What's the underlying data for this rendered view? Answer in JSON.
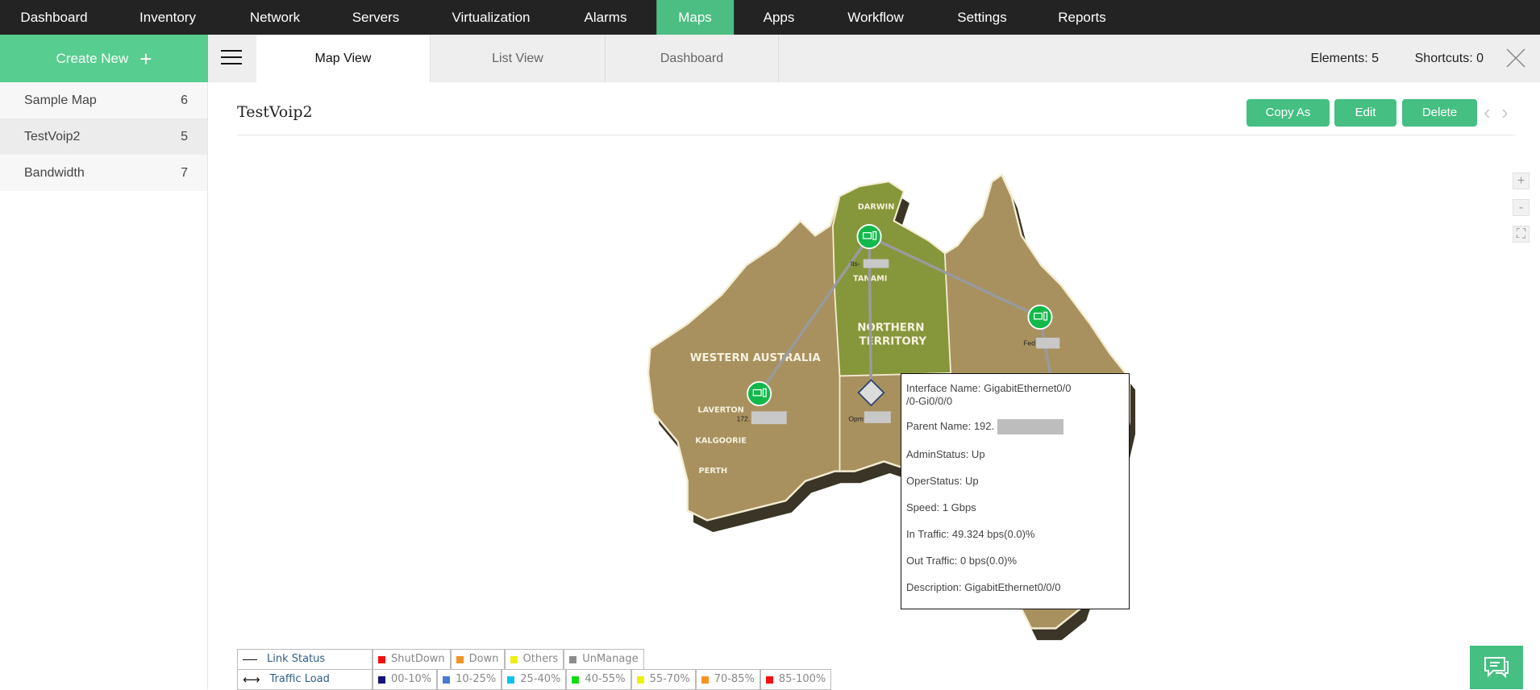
{
  "nav": {
    "items": [
      "Dashboard",
      "Inventory",
      "Network",
      "Servers",
      "Virtualization",
      "Alarms",
      "Maps",
      "Apps",
      "Workflow",
      "Settings",
      "Reports"
    ],
    "active": "Maps"
  },
  "create_new": {
    "label": "Create New",
    "icon": "plus-icon"
  },
  "tabs": [
    "Map View",
    "List View",
    "Dashboard"
  ],
  "counts": {
    "elements": "Elements: 5",
    "shortcuts": "Shortcuts: 0"
  },
  "sidebar": {
    "items": [
      {
        "label": "Sample Map",
        "count": "6"
      },
      {
        "label": "TestVoip2",
        "count": "5"
      },
      {
        "label": "Bandwidth",
        "count": "7"
      }
    ]
  },
  "page_title": "TestVoip2",
  "actions": {
    "copy_as": "Copy As",
    "edit": "Edit",
    "delete": "Delete"
  },
  "zoom_controls": {
    "zoom_in": "+",
    "zoom_out": "-"
  },
  "map": {
    "places": {
      "darwin": "DARWIN",
      "tanami": "TANAMI",
      "nt1": "NORTHERN",
      "nt2": "TERRITORY",
      "wa": "WESTERN AUSTRALIA",
      "laverton": "LAVERTON",
      "kalgoorie": "KALGOORIE",
      "perth": "PERTH"
    },
    "nodes": [
      {
        "label": "Its-",
        "status_color": "#12b94a"
      },
      {
        "label": "Fed",
        "status_color": "#12b94a"
      },
      {
        "label": "172.",
        "status_color": "#12b94a"
      },
      {
        "label": "Opm",
        "type": "interface"
      }
    ]
  },
  "tooltip": {
    "interface_name_1": "Interface Name: GigabitEthernet0/0",
    "interface_name_2": "/0-Gi0/0/0",
    "parent_name": "Parent Name: 192.",
    "admin_status": "AdminStatus: Up",
    "oper_status": "OperStatus: Up",
    "speed": "Speed: 1 Gbps",
    "in_traffic": "In Traffic: 49.324 bps(0.0)%",
    "out_traffic": "Out Traffic: 0 bps(0.0)%",
    "description": "Description: GigabitEthernet0/0/0"
  },
  "legend": {
    "link_status": {
      "label": "Link Status",
      "items": [
        {
          "label": "ShutDown",
          "color": "#ee1111"
        },
        {
          "label": "Down",
          "color": "#f39325"
        },
        {
          "label": "Others",
          "color": "#eeee11"
        },
        {
          "label": "UnManage",
          "color": "#8c8c8c"
        }
      ]
    },
    "traffic_load": {
      "label": "Traffic Load",
      "items": [
        {
          "label": "00-10%",
          "color": "#13137a"
        },
        {
          "label": "10-25%",
          "color": "#4a78d6"
        },
        {
          "label": "25-40%",
          "color": "#10c0f0"
        },
        {
          "label": "40-55%",
          "color": "#11dd11"
        },
        {
          "label": "55-70%",
          "color": "#eeee11"
        },
        {
          "label": "70-85%",
          "color": "#f39325"
        },
        {
          "label": "85-100%",
          "color": "#ee1111"
        }
      ]
    }
  }
}
